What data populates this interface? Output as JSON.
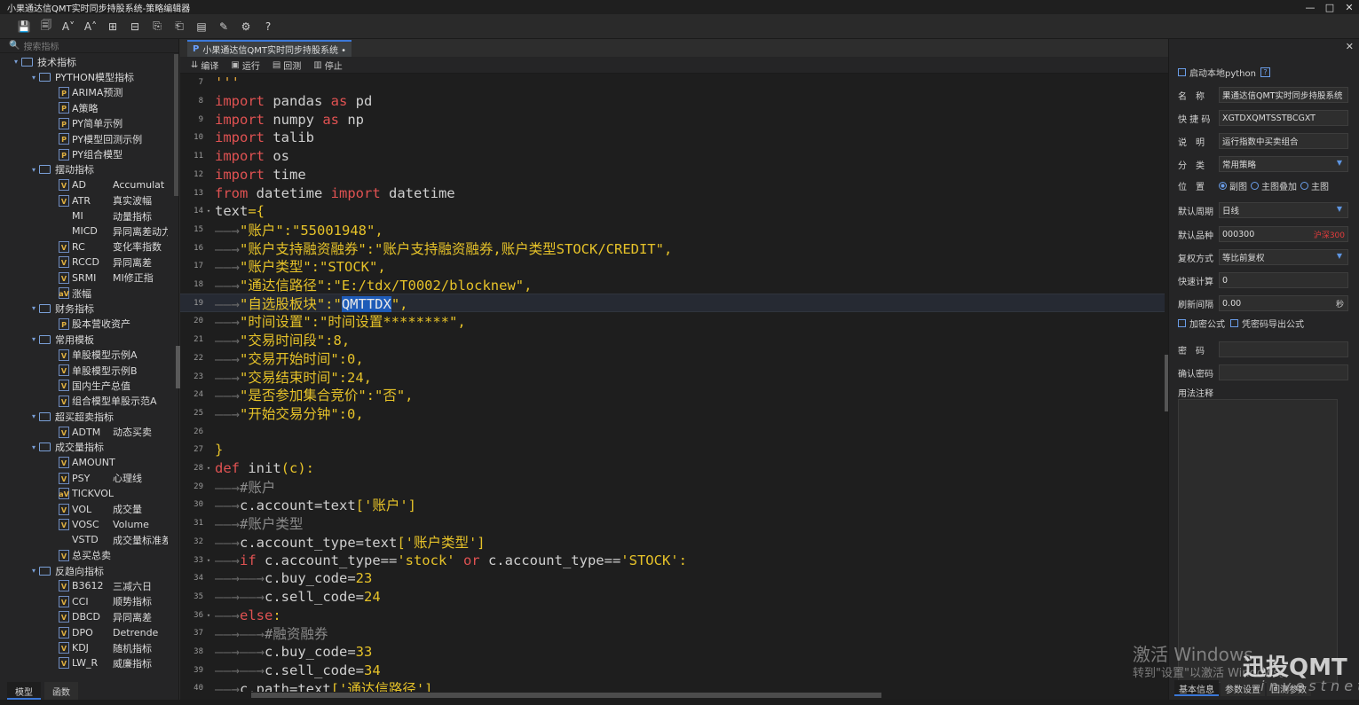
{
  "window": {
    "title": "小果通达信QMT实时同步持股系统-策略编辑器",
    "controls": [
      "—",
      "□",
      "✕"
    ]
  },
  "toolbar": {
    "icons": [
      "save-icon",
      "save-all-icon",
      "font-decrease-icon",
      "font-increase-icon",
      "export-icon",
      "import-icon",
      "copy-icon",
      "paste-icon",
      "doc-icon",
      "doc-edit-icon",
      "settings-icon",
      "help-icon"
    ],
    "glyphs": [
      "💾",
      "🗐",
      "A˅",
      "A˄",
      "⊞",
      "⊟",
      "⎘",
      "⎗",
      "▤",
      "✎",
      "⚙",
      "?"
    ]
  },
  "sidebar": {
    "search_placeholder": "搜索指标",
    "tree": [
      {
        "level": 0,
        "type": "folder",
        "label": "技术指标"
      },
      {
        "level": 1,
        "type": "folder",
        "label": "PYTHON模型指标"
      },
      {
        "level": 2,
        "type": "item",
        "badge": "P",
        "name": "ARIMA预测",
        "desc": ""
      },
      {
        "level": 2,
        "type": "item",
        "badge": "P",
        "name": "A策略",
        "desc": ""
      },
      {
        "level": 2,
        "type": "item",
        "badge": "P",
        "name": "PY简单示例",
        "desc": ""
      },
      {
        "level": 2,
        "type": "item",
        "badge": "P",
        "name": "PY模型回测示例",
        "desc": ""
      },
      {
        "level": 2,
        "type": "item",
        "badge": "P",
        "name": "PY组合模型",
        "desc": ""
      },
      {
        "level": 1,
        "type": "folder",
        "label": "摆动指标"
      },
      {
        "level": 2,
        "type": "item",
        "badge": "V",
        "name": "AD",
        "desc": "Accumulat"
      },
      {
        "level": 2,
        "type": "item",
        "badge": "V",
        "name": "ATR",
        "desc": "真实波幅"
      },
      {
        "level": 2,
        "type": "item",
        "badge": "",
        "name": "MI",
        "desc": "动量指标"
      },
      {
        "level": 2,
        "type": "item",
        "badge": "",
        "name": "MICD",
        "desc": "异同离差动力"
      },
      {
        "level": 2,
        "type": "item",
        "badge": "V",
        "name": "RC",
        "desc": "变化率指数"
      },
      {
        "level": 2,
        "type": "item",
        "badge": "V",
        "name": "RCCD",
        "desc": "异同离差"
      },
      {
        "level": 2,
        "type": "item",
        "badge": "V",
        "name": "SRMI",
        "desc": "MI修正指"
      },
      {
        "level": 2,
        "type": "item",
        "badge": "aV",
        "name": "涨幅",
        "desc": ""
      },
      {
        "level": 1,
        "type": "folder",
        "label": "财务指标"
      },
      {
        "level": 2,
        "type": "item",
        "badge": "P",
        "name": "股本营收资产",
        "desc": ""
      },
      {
        "level": 1,
        "type": "folder",
        "label": "常用模板"
      },
      {
        "level": 2,
        "type": "item",
        "badge": "V",
        "name": "单股模型示例A",
        "desc": ""
      },
      {
        "level": 2,
        "type": "item",
        "badge": "V",
        "name": "单股模型示例B",
        "desc": ""
      },
      {
        "level": 2,
        "type": "item",
        "badge": "V",
        "name": "国内生产总值",
        "desc": ""
      },
      {
        "level": 2,
        "type": "item",
        "badge": "V",
        "name": "组合模型单股示范A",
        "desc": ""
      },
      {
        "level": 1,
        "type": "folder",
        "label": "超买超卖指标"
      },
      {
        "level": 2,
        "type": "item",
        "badge": "V",
        "name": "ADTM",
        "desc": "动态买卖"
      },
      {
        "level": 1,
        "type": "folder",
        "label": "成交量指标"
      },
      {
        "level": 2,
        "type": "item",
        "badge": "V",
        "name": "AMOUNT",
        "desc": ""
      },
      {
        "level": 2,
        "type": "item",
        "badge": "V",
        "name": "PSY",
        "desc": "心理线"
      },
      {
        "level": 2,
        "type": "item",
        "badge": "aV",
        "name": "TICKVOL",
        "desc": ""
      },
      {
        "level": 2,
        "type": "item",
        "badge": "V",
        "name": "VOL",
        "desc": "成交量"
      },
      {
        "level": 2,
        "type": "item",
        "badge": "V",
        "name": "VOSC",
        "desc": "Volume"
      },
      {
        "level": 2,
        "type": "item",
        "badge": "",
        "name": "VSTD",
        "desc": "成交量标准差"
      },
      {
        "level": 2,
        "type": "item",
        "badge": "V",
        "name": "总买总卖",
        "desc": ""
      },
      {
        "level": 1,
        "type": "folder",
        "label": "反趋向指标"
      },
      {
        "level": 2,
        "type": "item",
        "badge": "V",
        "name": "B3612",
        "desc": "三减六日"
      },
      {
        "level": 2,
        "type": "item",
        "badge": "V",
        "name": "CCI",
        "desc": "顺势指标"
      },
      {
        "level": 2,
        "type": "item",
        "badge": "V",
        "name": "DBCD",
        "desc": "异同离差"
      },
      {
        "level": 2,
        "type": "item",
        "badge": "V",
        "name": "DPO",
        "desc": "Detrende"
      },
      {
        "level": 2,
        "type": "item",
        "badge": "V",
        "name": "KDJ",
        "desc": "随机指标"
      },
      {
        "level": 2,
        "type": "item",
        "badge": "V",
        "name": "LW_R",
        "desc": "威廉指标"
      }
    ],
    "tabs": [
      "模型",
      "函数"
    ]
  },
  "editor": {
    "tab_label": "小果通达信QMT实时同步持股系统 •",
    "tab_badge": "P",
    "actions": [
      {
        "icon": "⇊",
        "label": "编译"
      },
      {
        "icon": "▣",
        "label": "运行"
      },
      {
        "icon": "▤",
        "label": "回测"
      },
      {
        "icon": "▥",
        "label": "停止"
      }
    ],
    "current_line": 19,
    "lines": [
      {
        "n": 7,
        "fold": "",
        "tokens": [
          [
            "'''",
            "#e6a83a"
          ]
        ]
      },
      {
        "n": 8,
        "fold": "",
        "tokens": [
          [
            "import",
            "#e05252"
          ],
          [
            " pandas ",
            "#cfcfcf"
          ],
          [
            "as",
            "#e05252"
          ],
          [
            " pd",
            "#cfcfcf"
          ]
        ]
      },
      {
        "n": 9,
        "fold": "",
        "tokens": [
          [
            "import",
            "#e05252"
          ],
          [
            " numpy ",
            "#cfcfcf"
          ],
          [
            "as",
            "#e05252"
          ],
          [
            " np",
            "#cfcfcf"
          ]
        ]
      },
      {
        "n": 10,
        "fold": "",
        "tokens": [
          [
            "import",
            "#e05252"
          ],
          [
            " talib",
            "#cfcfcf"
          ]
        ]
      },
      {
        "n": 11,
        "fold": "",
        "tokens": [
          [
            "import",
            "#e05252"
          ],
          [
            " os",
            "#cfcfcf"
          ]
        ]
      },
      {
        "n": 12,
        "fold": "",
        "tokens": [
          [
            "import",
            "#e05252"
          ],
          [
            " time",
            "#cfcfcf"
          ]
        ]
      },
      {
        "n": 13,
        "fold": "",
        "tokens": [
          [
            "from",
            "#e05252"
          ],
          [
            " datetime ",
            "#cfcfcf"
          ],
          [
            "import",
            "#e05252"
          ],
          [
            " datetime",
            "#cfcfcf"
          ]
        ]
      },
      {
        "n": 14,
        "fold": "▾",
        "tokens": [
          [
            "text",
            "#cfcfcf"
          ],
          [
            "={",
            "#e6c229"
          ]
        ]
      },
      {
        "n": 15,
        "fold": "",
        "tokens": [
          [
            "——→",
            "#6a6a6a"
          ],
          [
            "\"账户\":\"55001948\",",
            "#e6c229"
          ]
        ]
      },
      {
        "n": 16,
        "fold": "",
        "tokens": [
          [
            "——→",
            "#6a6a6a"
          ],
          [
            "\"账户支持融资融券\":\"账户支持融资融券,账户类型STOCK/CREDIT\",",
            "#e6c229"
          ]
        ]
      },
      {
        "n": 17,
        "fold": "",
        "tokens": [
          [
            "——→",
            "#6a6a6a"
          ],
          [
            "\"账户类型\":\"STOCK\",",
            "#e6c229"
          ]
        ]
      },
      {
        "n": 18,
        "fold": "",
        "tokens": [
          [
            "——→",
            "#6a6a6a"
          ],
          [
            "\"通达信路径\":\"E:/tdx/T0002/blocknew\",",
            "#e6c229"
          ]
        ]
      },
      {
        "n": 19,
        "fold": "",
        "tokens": [
          [
            "——→",
            "#6a6a6a"
          ],
          [
            "\"自选股板块\":\"",
            "#e6c229"
          ],
          [
            "QMTTDX",
            "hl"
          ],
          [
            "\",",
            "#e6c229"
          ]
        ]
      },
      {
        "n": 20,
        "fold": "",
        "tokens": [
          [
            "——→",
            "#6a6a6a"
          ],
          [
            "\"时间设置\":\"时间设置********\",",
            "#e6c229"
          ]
        ]
      },
      {
        "n": 21,
        "fold": "",
        "tokens": [
          [
            "——→",
            "#6a6a6a"
          ],
          [
            "\"交易时间段\":8,",
            "#e6c229"
          ]
        ]
      },
      {
        "n": 22,
        "fold": "",
        "tokens": [
          [
            "——→",
            "#6a6a6a"
          ],
          [
            "\"交易开始时间\":0,",
            "#e6c229"
          ]
        ]
      },
      {
        "n": 23,
        "fold": "",
        "tokens": [
          [
            "——→",
            "#6a6a6a"
          ],
          [
            "\"交易结束时间\":24,",
            "#e6c229"
          ]
        ]
      },
      {
        "n": 24,
        "fold": "",
        "tokens": [
          [
            "——→",
            "#6a6a6a"
          ],
          [
            "\"是否参加集合竞价\":\"否\",",
            "#e6c229"
          ]
        ]
      },
      {
        "n": 25,
        "fold": "",
        "tokens": [
          [
            "——→",
            "#6a6a6a"
          ],
          [
            "\"开始交易分钟\":0,",
            "#e6c229"
          ]
        ]
      },
      {
        "n": 26,
        "fold": "",
        "tokens": []
      },
      {
        "n": 27,
        "fold": "",
        "tokens": [
          [
            "}",
            "#e6c229"
          ]
        ]
      },
      {
        "n": 28,
        "fold": "▾",
        "tokens": [
          [
            "def",
            "#e05252"
          ],
          [
            " init",
            "#cfcfcf"
          ],
          [
            "(c):",
            "#e6c229"
          ]
        ]
      },
      {
        "n": 29,
        "fold": "",
        "tokens": [
          [
            "——→",
            "#6a6a6a"
          ],
          [
            "#账户",
            "#8a8a8a"
          ]
        ]
      },
      {
        "n": 30,
        "fold": "",
        "tokens": [
          [
            "——→",
            "#6a6a6a"
          ],
          [
            "c.account=text",
            "#cfcfcf"
          ],
          [
            "['账户']",
            "#e6c229"
          ]
        ]
      },
      {
        "n": 31,
        "fold": "",
        "tokens": [
          [
            "——→",
            "#6a6a6a"
          ],
          [
            "#账户类型",
            "#8a8a8a"
          ]
        ]
      },
      {
        "n": 32,
        "fold": "",
        "tokens": [
          [
            "——→",
            "#6a6a6a"
          ],
          [
            "c.account_type=text",
            "#cfcfcf"
          ],
          [
            "['账户类型']",
            "#e6c229"
          ]
        ]
      },
      {
        "n": 33,
        "fold": "▾",
        "tokens": [
          [
            "——→",
            "#6a6a6a"
          ],
          [
            "if",
            "#e05252"
          ],
          [
            " c.account_type==",
            "#cfcfcf"
          ],
          [
            "'stock'",
            "#e6c229"
          ],
          [
            " or ",
            "#e05252"
          ],
          [
            "c.account_type==",
            "#cfcfcf"
          ],
          [
            "'STOCK':",
            "#e6c229"
          ]
        ]
      },
      {
        "n": 34,
        "fold": "",
        "tokens": [
          [
            "——→——→",
            "#6a6a6a"
          ],
          [
            "c.buy_code=",
            "#cfcfcf"
          ],
          [
            "23",
            "#e6c229"
          ]
        ]
      },
      {
        "n": 35,
        "fold": "",
        "tokens": [
          [
            "——→——→",
            "#6a6a6a"
          ],
          [
            "c.sell_code=",
            "#cfcfcf"
          ],
          [
            "24",
            "#e6c229"
          ]
        ]
      },
      {
        "n": 36,
        "fold": "▾",
        "tokens": [
          [
            "——→",
            "#6a6a6a"
          ],
          [
            "else",
            "#e05252"
          ],
          [
            ":",
            "#e6c229"
          ]
        ]
      },
      {
        "n": 37,
        "fold": "",
        "tokens": [
          [
            "——→——→",
            "#6a6a6a"
          ],
          [
            "#融资融券",
            "#8a8a8a"
          ]
        ]
      },
      {
        "n": 38,
        "fold": "",
        "tokens": [
          [
            "——→——→",
            "#6a6a6a"
          ],
          [
            "c.buy_code=",
            "#cfcfcf"
          ],
          [
            "33",
            "#e6c229"
          ]
        ]
      },
      {
        "n": 39,
        "fold": "",
        "tokens": [
          [
            "——→——→",
            "#6a6a6a"
          ],
          [
            "c.sell_code=",
            "#cfcfcf"
          ],
          [
            "34",
            "#e6c229"
          ]
        ]
      },
      {
        "n": 40,
        "fold": "",
        "tokens": [
          [
            "——→",
            "#6a6a6a"
          ],
          [
            "c.path=text",
            "#cfcfcf"
          ],
          [
            "['通达信路径']",
            "#e6c229"
          ]
        ]
      }
    ]
  },
  "props": {
    "local_python_label": "启动本地python",
    "help_mark": "?",
    "fields": {
      "name_label": "名　称",
      "name_value": "果通达信QMT实时同步持股系统",
      "shortcut_label": "快 捷 码",
      "shortcut_value": "XGTDXQMTSSTBCGXT",
      "desc_label": "说　明",
      "desc_value": "运行指数中买卖组合",
      "category_label": "分　类",
      "category_value": "常用策略",
      "position_label": "位　置",
      "position_options": [
        "副图",
        "主图叠加",
        "主图"
      ],
      "period_label": "默认周期",
      "period_value": "日线",
      "symbol_label": "默认品种",
      "symbol_value": "000300",
      "symbol_market": "沪深300",
      "adjust_label": "复权方式",
      "adjust_value": "等比前复权",
      "quick_calc_label": "快速计算",
      "quick_calc_value": "0",
      "refresh_label": "刷新间隔",
      "refresh_value": "0.00",
      "refresh_unit": "秒",
      "encrypt_label": "加密公式",
      "export_label": "凭密码导出公式",
      "password_label": "密　码",
      "confirm_label": "确认密码",
      "notes_label": "用法注释"
    },
    "tabs": [
      "基本信息",
      "参数设置",
      "回测参数"
    ]
  },
  "overlay": {
    "activate_line1": "激活 Windows",
    "activate_line2": "转到\"设置\"以激活 Windows。",
    "brand": "迅投QMT",
    "brand_sub": "i n v e s t n e t"
  },
  "colors": {
    "accent": "#3b78d8",
    "keyword": "#e05252",
    "string": "#e6c229",
    "plain": "#cfcfcf",
    "comment": "#8a8a8a",
    "selection": "#1e5bb8"
  }
}
